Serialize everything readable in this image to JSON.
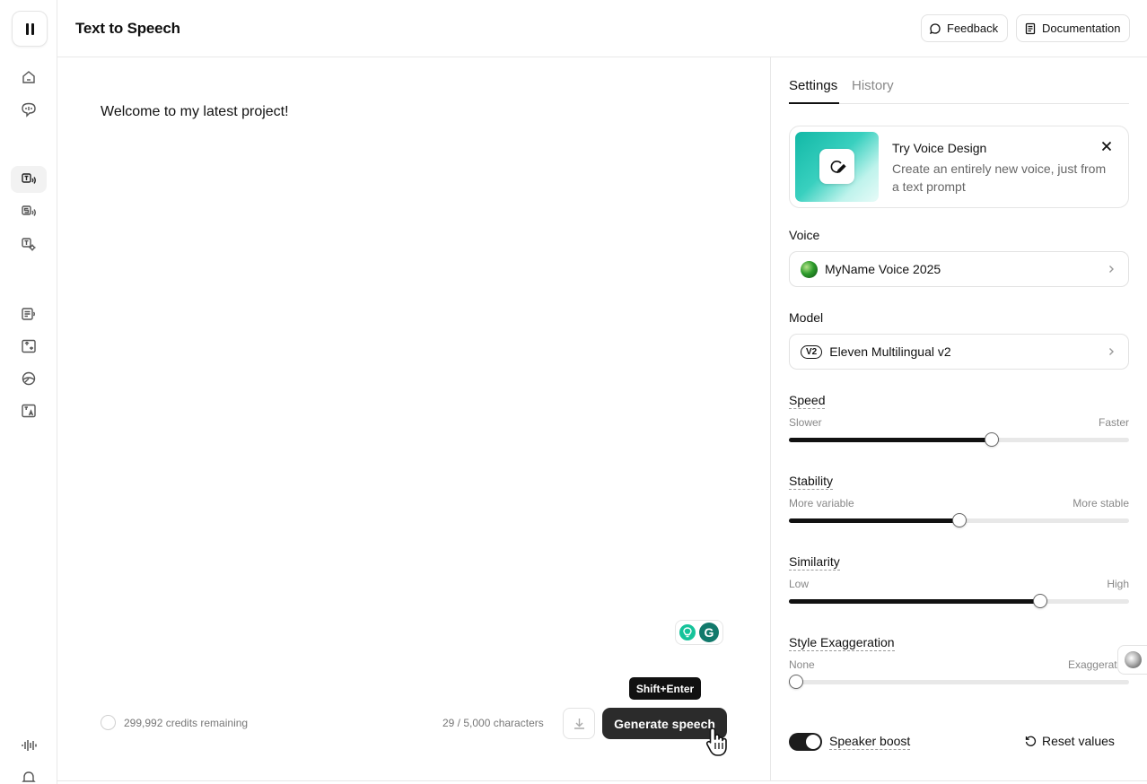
{
  "header": {
    "title": "Text to Speech",
    "feedback_label": "Feedback",
    "documentation_label": "Documentation"
  },
  "sidebar": {
    "items": [
      {
        "name": "home-icon"
      },
      {
        "name": "voices-icon"
      },
      {
        "name": "text-to-speech-icon",
        "active": true
      },
      {
        "name": "speech-to-speech-icon"
      },
      {
        "name": "sound-effects-icon"
      },
      {
        "name": "projects-icon"
      },
      {
        "name": "dubbing-icon"
      },
      {
        "name": "voice-isolator-icon"
      },
      {
        "name": "translate-icon"
      },
      {
        "name": "audio-waveform-icon"
      },
      {
        "name": "notifications-icon"
      }
    ]
  },
  "editor": {
    "text": "Welcome to my latest project!",
    "credits": "299,992 credits remaining",
    "char_count": "29 / 5,000 characters",
    "generate_label": "Generate speech",
    "tooltip": "Shift+Enter"
  },
  "panel": {
    "tabs": [
      {
        "label": "Settings",
        "active": true
      },
      {
        "label": "History",
        "active": false
      }
    ],
    "promo": {
      "title": "Try Voice Design",
      "description": "Create an entirely new voice, just from a text prompt"
    },
    "voice": {
      "label": "Voice",
      "value": "MyName Voice 2025"
    },
    "model": {
      "label": "Model",
      "badge": "V2",
      "value": "Eleven Multilingual v2"
    },
    "sliders": [
      {
        "label": "Speed",
        "min_label": "Slower",
        "max_label": "Faster",
        "value": 0.595
      },
      {
        "label": "Stability",
        "min_label": "More variable",
        "max_label": "More stable",
        "value": 0.5
      },
      {
        "label": "Similarity",
        "min_label": "Low",
        "max_label": "High",
        "value": 0.74
      },
      {
        "label": "Style Exaggeration",
        "min_label": "None",
        "max_label": "Exaggerated",
        "value": 0.0
      }
    ],
    "speaker_boost_label": "Speaker boost",
    "speaker_boost_on": true,
    "reset_label": "Reset values"
  }
}
